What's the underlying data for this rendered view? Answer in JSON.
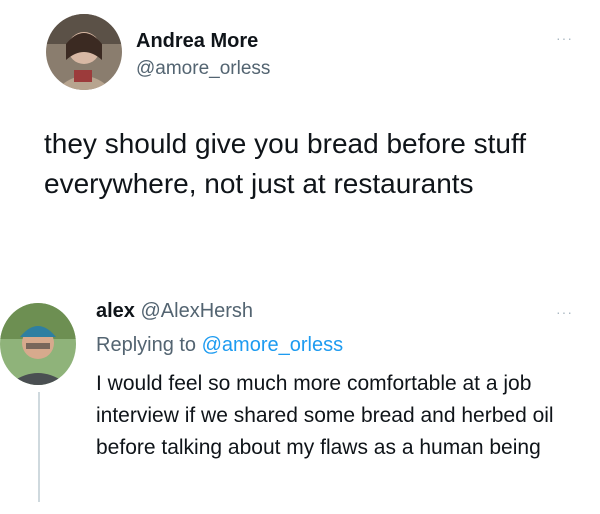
{
  "tweet": {
    "display_name": "Andrea More",
    "handle": "@amore_orless",
    "text": "they should give you bread before stuff everywhere, not just at restaurants",
    "more_icon": "···"
  },
  "reply": {
    "display_name": "alex",
    "handle": "@AlexHersh",
    "replying_prefix": "Replying to",
    "replying_to": "@amore_orless",
    "text": "I would feel so much more comfortable at a job interview if we shared some bread and herbed oil before talking about my flaws as a human being",
    "more_icon": "···"
  },
  "colors": {
    "text": "#0f1419",
    "secondary": "#536471",
    "link": "#1d9bf0",
    "thread_line": "#cfd9de"
  },
  "icons": [
    "more-icon",
    "avatar"
  ]
}
